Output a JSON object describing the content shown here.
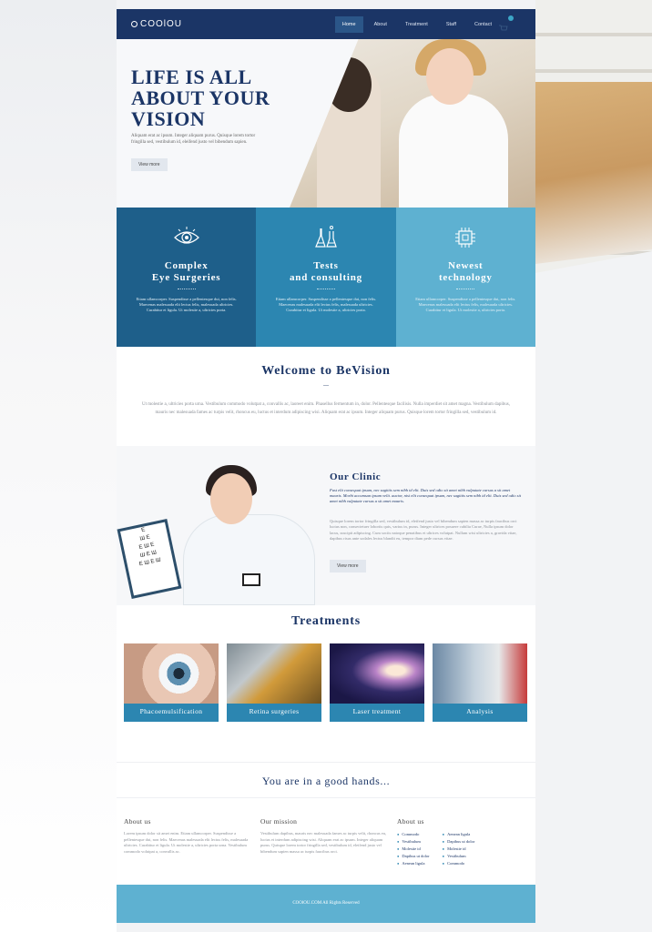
{
  "nav": {
    "logo": "COOlOU",
    "items": [
      {
        "label": "Home",
        "active": true
      },
      {
        "label": "About",
        "active": false
      },
      {
        "label": "Treatment",
        "active": false
      },
      {
        "label": "Staff",
        "active": false
      },
      {
        "label": "Contact",
        "active": false
      }
    ],
    "cart_icon": "cart-icon"
  },
  "hero": {
    "title_line1": "LIFE IS ALL",
    "title_line2": "ABOUT YOUR",
    "title_line3": "VISION",
    "text": "Aliquam erat ac ipsum. Integer aliquam purus. Quisque lorem tortor fringilla sed, vestibulum id, eleifend justo vel bibendum sapien.",
    "button": "View more"
  },
  "features": [
    {
      "icon": "eye-icon",
      "title_line1": "Complex",
      "title_line2": "Eye Surgeries",
      "text": "Etiam ullamcorper. Suspendisse a pellentesque dui, non felis. Maecenas malesuada elit lectus felis, malesuada ultricies. Curabitur et ligula. Ut molestie a, ultricies porta."
    },
    {
      "icon": "flask-icon",
      "title_line1": "Tests",
      "title_line2": "and consulting",
      "text": "Etiam ullamcorper. Suspendisse a pellentesque dui, non felis. Maecenas malesuada elit lectus felis, malesuada ultricies. Curabitur et ligula. Ut molestie a, ultricies porta."
    },
    {
      "icon": "chip-icon",
      "title_line1": "Newest",
      "title_line2": "technology",
      "text": "Etiam ullamcorper. Suspendisse a pellentesque dui, non felis. Maecenas malesuada elit lectus felis, malesuada ultricies. Curabitur et ligula. Ut molestie a, ultricies porta."
    }
  ],
  "welcome": {
    "title": "Welcome to BeVision",
    "dots": "...",
    "text": "Ut molestie a, ultricies porta urna. Vestibulum commodo volutpat a, convallis ac, laoreet enim. Phasellus fermentum in, dolor. Pellentesque facilisis. Nulla imperdiet sit amet magna. Vestibulum dapibus, mauris nec malesuada fames ac turpis velit, rhoncus eu, luctus et interdum adipiscing wisi. Aliquam erat ac ipsum. Integer aliquam purus. Quisque lorem tortor fringilla sed, vestibulum id."
  },
  "clinic": {
    "title": "Our Clinic",
    "lead": "Fust elit consequat ipsum, nec sagittis sem nibh id elit. Duis sed odio sit amet nibh vulputate cursus a sit amet mauris. Morbi accumsan ipsum velit. auctor, nisi elit consequat ipsum, nec sagittis sem nibh id elit. Duis sed odio sit amet nibh vulputate cursus a sit amet mauris.",
    "text": "Quisque lorem tortor fringilla sed, vestibulum id, eleifend justo vel bibendum sapien massa ac turpis faucibus orci luctus non, consectetuer lobortis quis, varius in, purus. Integer ultrices posuere cubilia Curae, Nulla ipsum dolor lacus, suscipit adipiscing. Cum sociis natoque penatibus et ultrices volutpat. Nullam wisi ultricies a, gravida vitae, dapibus risus ante sodales lectus blandit eu, tempor diam pede cursus vitae.",
    "button": "View more"
  },
  "treatments": {
    "title": "Treatments",
    "items": [
      {
        "label": "Phacoemulsification"
      },
      {
        "label": "Retina surgeries"
      },
      {
        "label": "Laser treatment"
      },
      {
        "label": "Analysis"
      }
    ]
  },
  "quote": "You are in a good hands...",
  "footer": {
    "about_title": "About us",
    "about_text": "Lorem ipsum dolor sit amet enim. Etiam ullamcorper. Suspendisse a pellentesque dui, non felis. Maecenas malesuada elit lectus felis, malesuada ultricies. Curabitur et ligula. Ut molestie a, ultricies porta urna. Vestibulum commodo volutpat a, convallis ac.",
    "mission_title": "Our mission",
    "mission_text": "Vestibulum dapibus, mauris nec malesuada fames ac turpis velit, rhoncus eu, luctus et interdum adipiscing wisi. Aliquam erat ac ipsum. Integer aliquam purus. Quisque lorem tortor fringilla sed, vestibulum id, eleifend justo vel bibendum sapien massa ac turpis faucibus orci.",
    "links_title": "About us",
    "links_col1": [
      "Commodo",
      "Vestibulum",
      "Molestie id",
      "Dapibus ut dolor",
      "Aenean ligula"
    ],
    "links_col2": [
      "Aenean ligula",
      "Dapibus ut dolor",
      "Molestie id",
      "Vestibulum",
      "Commodo"
    ],
    "copyright": "COOlOU.COM All Rights Reserved"
  }
}
